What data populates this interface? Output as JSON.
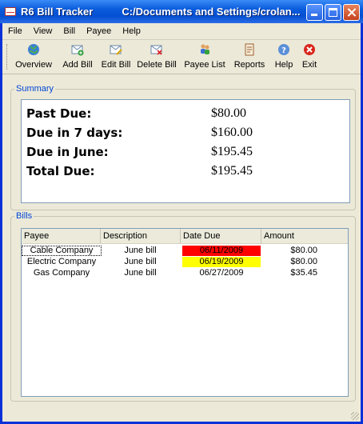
{
  "window": {
    "app_title": "R6 Bill Tracker",
    "path": "C:/Documents and Settings/crolan..."
  },
  "menu": [
    "File",
    "View",
    "Bill",
    "Payee",
    "Help"
  ],
  "toolbar": [
    {
      "label": "Overview",
      "icon": "globe-icon"
    },
    {
      "label": "Add Bill",
      "icon": "envelope-add-icon"
    },
    {
      "label": "Edit Bill",
      "icon": "envelope-edit-icon"
    },
    {
      "label": "Delete Bill",
      "icon": "envelope-delete-icon"
    },
    {
      "label": "Payee List",
      "icon": "people-icon"
    },
    {
      "label": "Reports",
      "icon": "report-book-icon"
    },
    {
      "label": "Help",
      "icon": "help-icon"
    },
    {
      "label": "Exit",
      "icon": "exit-icon"
    }
  ],
  "summary": {
    "title": "Summary",
    "rows": [
      {
        "label": "Past Due:",
        "value": "$80.00"
      },
      {
        "label": "Due in 7 days:",
        "value": "$160.00"
      },
      {
        "label": "Due in June:",
        "value": "$195.45"
      },
      {
        "label": "Total Due:",
        "value": "$195.45"
      }
    ]
  },
  "bills": {
    "title": "Bills",
    "columns": [
      "Payee",
      "Description",
      "Date Due",
      "Amount"
    ],
    "rows": [
      {
        "payee": "Cable Company",
        "description": "June bill",
        "date": "06/11/2009",
        "amount": "$80.00",
        "highlight": "#ff0000"
      },
      {
        "payee": "Electric Company",
        "description": "June bill",
        "date": "06/19/2009",
        "amount": "$80.00",
        "highlight": "#ffff00"
      },
      {
        "payee": "Gas Company",
        "description": "June bill",
        "date": "06/27/2009",
        "amount": "$35.45",
        "highlight": ""
      }
    ]
  },
  "colors": {
    "accent": "#0046d5",
    "overdue": "#ff0000",
    "due_soon": "#ffff00"
  }
}
